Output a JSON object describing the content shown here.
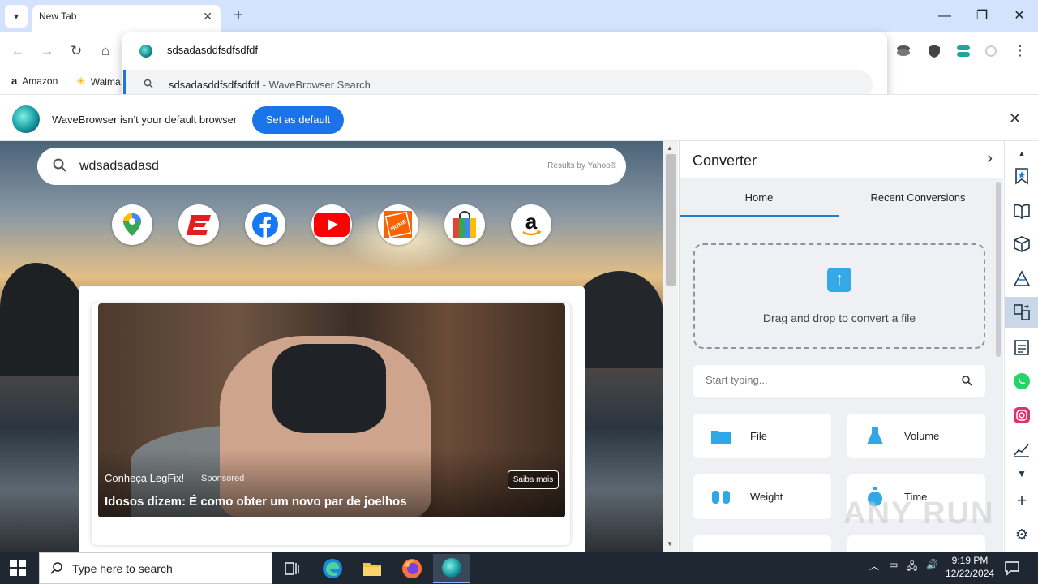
{
  "tab": {
    "title": "New Tab"
  },
  "omnibox": {
    "value": "sdsadasddfsdfsdfdf",
    "suggestion_query": "sdsadasddfsdfsdfdf",
    "suggestion_suffix": " - WaveBrowser Search"
  },
  "bookmarks": [
    {
      "label": "Amazon",
      "icon": "amazon-icon"
    },
    {
      "label": "Walma",
      "icon": "walmart-icon"
    }
  ],
  "infobar": {
    "message": "WaveBrowser isn't your default browser",
    "button": "Set as default"
  },
  "newtab": {
    "search_value": "wdsadsadasd",
    "results_by": "Results by Yahoo®",
    "shortcuts": [
      "google-maps-icon",
      "espn-icon",
      "facebook-icon",
      "youtube-icon",
      "home-depot-icon",
      "shopping-bag-icon",
      "amazon-icon"
    ],
    "ad": {
      "brand": "Conheça LegFix!",
      "sponsored": "Sponsored",
      "title": "Idosos dizem: É como obter um novo par de joelhos",
      "cta": "Saiba mais"
    }
  },
  "converter": {
    "title": "Converter",
    "tabs": [
      "Home",
      "Recent Conversions"
    ],
    "drop_text": "Drag and drop to convert a file",
    "search_placeholder": "Start typing...",
    "tiles": [
      {
        "label": "File",
        "icon": "folder-icon"
      },
      {
        "label": "Volume",
        "icon": "flask-icon"
      },
      {
        "label": "Weight",
        "icon": "dumbbell-icon"
      },
      {
        "label": "Time",
        "icon": "stopwatch-icon"
      }
    ]
  },
  "taskbar": {
    "search_placeholder": "Type here to search",
    "time": "9:19 PM",
    "date": "12/22/2024"
  },
  "watermark": "ANY RUN",
  "colors": {
    "accent": "#1a73e8",
    "titlebar": "#d3e3fd",
    "taskbar": "#1f2733"
  }
}
